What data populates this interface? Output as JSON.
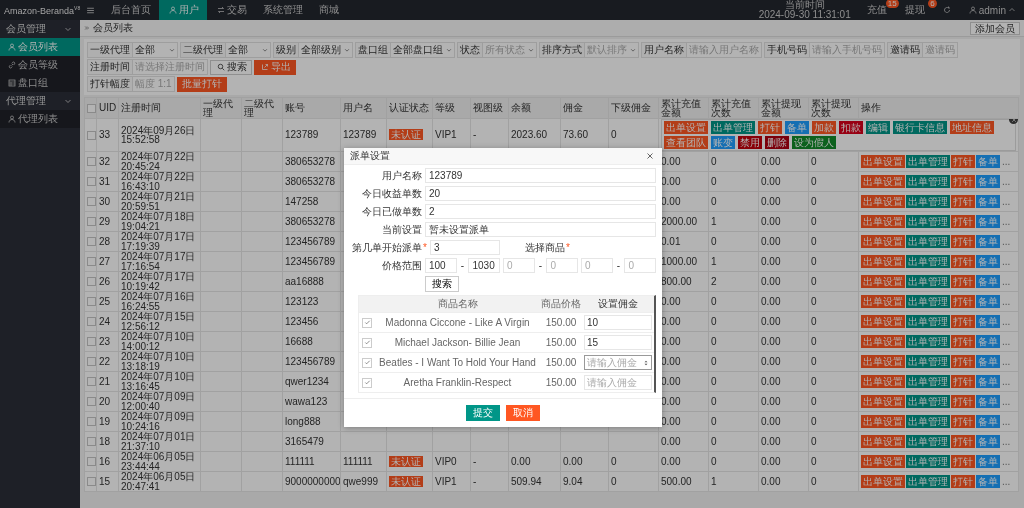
{
  "app": {
    "logo": "Amazon-Beranda",
    "version": "V8"
  },
  "top_nav": [
    {
      "label": "后台首页",
      "selected": false
    },
    {
      "label": "用户",
      "selected": true
    },
    {
      "label": "交易",
      "selected": false
    },
    {
      "label": "系统管理",
      "selected": false
    },
    {
      "label": "商城",
      "selected": false
    }
  ],
  "top_right": {
    "time_label": "当前时间",
    "time": "2024-09-30 11:31:01",
    "links": [
      {
        "label": "充值",
        "count": "15"
      },
      {
        "label": "提现",
        "count": "6"
      }
    ],
    "user": "admin"
  },
  "sidebar": [
    {
      "label": "会员管理",
      "expanded": true,
      "children": [
        {
          "label": "会员列表",
          "selected": true
        },
        {
          "label": "会员等级",
          "selected": false
        },
        {
          "label": "盘口组",
          "selected": false
        }
      ]
    },
    {
      "label": "代理管理",
      "expanded": true,
      "children": [
        {
          "label": "代理列表",
          "selected": false
        }
      ]
    }
  ],
  "breadcrumb": "会员列表",
  "add_button": "添加会员",
  "filter_rows": [
    [
      {
        "kind": "select",
        "label": "一级代理",
        "value": "全部"
      },
      {
        "kind": "select",
        "label": "二级代理",
        "value": "全部"
      },
      {
        "kind": "select",
        "label": "级别",
        "value": "全部级别"
      },
      {
        "kind": "select",
        "label": "盘口组",
        "value": "全部盘口组"
      },
      {
        "kind": "select",
        "label": "状态",
        "placeholder": "所有状态"
      },
      {
        "kind": "select",
        "label": "排序方式",
        "placeholder": "默认排序"
      },
      {
        "kind": "input",
        "label": "用户名称",
        "placeholder": "请输入用户名称"
      },
      {
        "kind": "input",
        "label": "手机号码",
        "placeholder": "请输入手机号码"
      },
      {
        "kind": "input",
        "label": "邀请码",
        "placeholder": "邀请码"
      }
    ],
    [
      {
        "kind": "input",
        "label": "注册时间",
        "placeholder": "请选择注册时间"
      },
      {
        "kind": "search",
        "label": "搜索"
      },
      {
        "kind": "export",
        "label": "导出"
      }
    ],
    [
      {
        "kind": "input",
        "label": "打针幅度",
        "placeholder": "幅度 1:1"
      },
      {
        "kind": "danger",
        "label": "批量打针"
      }
    ]
  ],
  "table": {
    "all_checked": false,
    "columns": [
      "UID",
      "注册时间",
      "一级代理",
      "二级代理",
      "账号",
      "用户名",
      "认证状态",
      "等级",
      "视图级",
      "余额",
      "佣金",
      "下级佣金",
      "累计充值金额",
      "累计充值次数",
      "累计提现金额",
      "累计提现次数",
      "操作"
    ],
    "rows": [
      {
        "checked": false,
        "cells": [
          "33",
          "2024年09月26日 15:52:58",
          null,
          null,
          "123789",
          "123789",
          "未认证",
          "VIP1",
          "-",
          "2023.60",
          "73.60",
          "0"
        ],
        "menu_open": true,
        "menu": [
          {
            "label": "出单设置",
            "color": "#b33d18"
          },
          {
            "label": "出单管理",
            "color": "#00695f"
          },
          {
            "label": "打针",
            "color": "#b33d18"
          },
          {
            "label": "备单",
            "color": "#156fb3"
          },
          {
            "label": "加款",
            "color": "#b33d18"
          },
          {
            "label": "扣款",
            "color": "#980013"
          },
          {
            "label": "编辑",
            "color": "#00695f"
          },
          {
            "label": "银行卡信息",
            "color": "#00695f"
          },
          {
            "label": "地址信息",
            "color": "#b33d18"
          },
          {
            "label": "查看团队",
            "color": "#b33d18"
          },
          {
            "label": "账变",
            "color": "#156fb3"
          },
          {
            "label": "禁用",
            "color": "#890008"
          },
          {
            "label": "删除",
            "color": "#7b000b"
          },
          {
            "label": "设为假人",
            "color": "#0c611d"
          }
        ]
      },
      {
        "checked": false,
        "cells": [
          "32",
          "2024年07月22日 20:45:24",
          null,
          null,
          "380653278",
          null,
          null,
          null,
          null,
          null,
          null,
          null
        ],
        "totals": [
          "0.00",
          "0",
          "0.00",
          "0"
        ],
        "menu_open": false,
        "ops": [
          {
            "label": "出单设置",
            "color": "#b33d18"
          },
          {
            "label": "出单管理",
            "color": "#00695f"
          },
          {
            "label": "打针",
            "color": "#b33d18"
          },
          {
            "label": "备单",
            "color": "#156fb3"
          }
        ],
        "more": "..."
      },
      {
        "checked": false,
        "cells": [
          "31",
          "2024年07月22日 16:43:10",
          null,
          null,
          "380653278",
          null,
          null,
          null,
          null,
          null,
          null,
          null
        ],
        "totals": [
          "0.00",
          "0",
          "0.00",
          "0"
        ],
        "menu_open": false,
        "ops": [
          {
            "label": "出单设置",
            "color": "#b33d18"
          },
          {
            "label": "出单管理",
            "color": "#00695f"
          },
          {
            "label": "打针",
            "color": "#b33d18"
          },
          {
            "label": "备单",
            "color": "#156fb3"
          }
        ],
        "more": "..."
      },
      {
        "checked": false,
        "cells": [
          "30",
          "2024年07月21日 20:59:51",
          null,
          null,
          "147258",
          null,
          null,
          null,
          null,
          null,
          null,
          null
        ],
        "totals": [
          "0.00",
          "0",
          "0.00",
          "0"
        ],
        "menu_open": false,
        "ops": [
          {
            "label": "出单设置",
            "color": "#b33d18"
          },
          {
            "label": "出单管理",
            "color": "#00695f"
          },
          {
            "label": "打针",
            "color": "#b33d18"
          },
          {
            "label": "备单",
            "color": "#156fb3"
          }
        ],
        "more": "..."
      },
      {
        "checked": false,
        "cells": [
          "29",
          "2024年07月18日 19:04:21",
          null,
          null,
          "380653278",
          null,
          null,
          null,
          null,
          null,
          null,
          null
        ],
        "totals": [
          "2000.00",
          "1",
          "0.00",
          "0"
        ],
        "menu_open": false,
        "ops": [
          {
            "label": "出单设置",
            "color": "#b33d18"
          },
          {
            "label": "出单管理",
            "color": "#00695f"
          },
          {
            "label": "打针",
            "color": "#b33d18"
          },
          {
            "label": "备单",
            "color": "#156fb3"
          }
        ],
        "more": "..."
      },
      {
        "checked": false,
        "cells": [
          "28",
          "2024年07月17日 17:19:39",
          null,
          null,
          "123456789",
          null,
          null,
          null,
          null,
          null,
          null,
          null
        ],
        "totals": [
          "0.01",
          "0",
          "0.00",
          "0"
        ],
        "menu_open": false,
        "ops": [
          {
            "label": "出单设置",
            "color": "#b33d18"
          },
          {
            "label": "出单管理",
            "color": "#00695f"
          },
          {
            "label": "打针",
            "color": "#b33d18"
          },
          {
            "label": "备单",
            "color": "#156fb3"
          }
        ],
        "more": "..."
      },
      {
        "checked": false,
        "cells": [
          "27",
          "2024年07月17日 17:16:54",
          null,
          null,
          "123456789",
          null,
          null,
          null,
          null,
          null,
          null,
          null
        ],
        "totals": [
          "1000.00",
          "1",
          "0.00",
          "0"
        ],
        "menu_open": false,
        "ops": [
          {
            "label": "出单设置",
            "color": "#b33d18"
          },
          {
            "label": "出单管理",
            "color": "#00695f"
          },
          {
            "label": "打针",
            "color": "#b33d18"
          },
          {
            "label": "备单",
            "color": "#156fb3"
          }
        ],
        "more": "..."
      },
      {
        "checked": false,
        "cells": [
          "26",
          "2024年07月17日 10:19:42",
          null,
          null,
          "aa16888",
          null,
          null,
          null,
          null,
          null,
          null,
          null
        ],
        "totals": [
          "800.00",
          "2",
          "0.00",
          "0"
        ],
        "menu_open": false,
        "ops": [
          {
            "label": "出单设置",
            "color": "#b33d18"
          },
          {
            "label": "出单管理",
            "color": "#00695f"
          },
          {
            "label": "打针",
            "color": "#b33d18"
          },
          {
            "label": "备单",
            "color": "#156fb3"
          }
        ],
        "more": "..."
      },
      {
        "checked": false,
        "cells": [
          "25",
          "2024年07月16日 16:24:55",
          null,
          null,
          "123123",
          null,
          null,
          null,
          null,
          null,
          null,
          null
        ],
        "totals": [
          "0.00",
          "0",
          "0.00",
          "0"
        ],
        "menu_open": false,
        "ops": [
          {
            "label": "出单设置",
            "color": "#b33d18"
          },
          {
            "label": "出单管理",
            "color": "#00695f"
          },
          {
            "label": "打针",
            "color": "#b33d18"
          },
          {
            "label": "备单",
            "color": "#156fb3"
          }
        ],
        "more": "..."
      },
      {
        "checked": false,
        "cells": [
          "24",
          "2024年07月15日 12:56:12",
          null,
          null,
          "123456",
          null,
          null,
          null,
          null,
          null,
          null,
          null
        ],
        "totals": [
          "0.00",
          "0",
          "0.00",
          "0"
        ],
        "menu_open": false,
        "ops": [
          {
            "label": "出单设置",
            "color": "#b33d18"
          },
          {
            "label": "出单管理",
            "color": "#00695f"
          },
          {
            "label": "打针",
            "color": "#b33d18"
          },
          {
            "label": "备单",
            "color": "#156fb3"
          }
        ],
        "more": "..."
      },
      {
        "checked": false,
        "cells": [
          "23",
          "2024年07月10日 14:00:12",
          null,
          null,
          "16688",
          null,
          null,
          null,
          null,
          null,
          null,
          null
        ],
        "totals": [
          "0.00",
          "0",
          "0.00",
          "0"
        ],
        "menu_open": false,
        "ops": [
          {
            "label": "出单设置",
            "color": "#b33d18"
          },
          {
            "label": "出单管理",
            "color": "#00695f"
          },
          {
            "label": "打针",
            "color": "#b33d18"
          },
          {
            "label": "备单",
            "color": "#156fb3"
          }
        ],
        "more": "..."
      },
      {
        "checked": false,
        "cells": [
          "22",
          "2024年07月10日 13:18:19",
          null,
          null,
          "123456789",
          null,
          null,
          null,
          null,
          null,
          null,
          null
        ],
        "totals": [
          "0.00",
          "0",
          "0.00",
          "0"
        ],
        "menu_open": false,
        "ops": [
          {
            "label": "出单设置",
            "color": "#b33d18"
          },
          {
            "label": "出单管理",
            "color": "#00695f"
          },
          {
            "label": "打针",
            "color": "#b33d18"
          },
          {
            "label": "备单",
            "color": "#156fb3"
          }
        ],
        "more": "..."
      },
      {
        "checked": false,
        "cells": [
          "21",
          "2024年07月10日 13:16:45",
          null,
          null,
          "qwer1234",
          null,
          null,
          null,
          null,
          null,
          null,
          null
        ],
        "totals": [
          "0.00",
          "0",
          "0.00",
          "0"
        ],
        "menu_open": false,
        "ops": [
          {
            "label": "出单设置",
            "color": "#b33d18"
          },
          {
            "label": "出单管理",
            "color": "#00695f"
          },
          {
            "label": "打针",
            "color": "#b33d18"
          },
          {
            "label": "备单",
            "color": "#156fb3"
          }
        ],
        "more": "..."
      },
      {
        "checked": false,
        "cells": [
          "20",
          "2024年07月09日 12:00:40",
          null,
          null,
          "wawa123",
          null,
          null,
          null,
          null,
          null,
          null,
          null
        ],
        "totals": [
          "0.00",
          "0",
          "0.00",
          "0"
        ],
        "menu_open": false,
        "ops": [
          {
            "label": "出单设置",
            "color": "#b33d18"
          },
          {
            "label": "出单管理",
            "color": "#00695f"
          },
          {
            "label": "打针",
            "color": "#b33d18"
          },
          {
            "label": "备单",
            "color": "#156fb3"
          }
        ],
        "more": "..."
      },
      {
        "checked": false,
        "cells": [
          "19",
          "2024年07月09日 10:24:16",
          null,
          null,
          "long888",
          null,
          null,
          null,
          null,
          null,
          null,
          null
        ],
        "totals": [
          "0.00",
          "0",
          "0.00",
          "0"
        ],
        "menu_open": false,
        "ops": [
          {
            "label": "出单设置",
            "color": "#b33d18"
          },
          {
            "label": "出单管理",
            "color": "#00695f"
          },
          {
            "label": "打针",
            "color": "#b33d18"
          },
          {
            "label": "备单",
            "color": "#156fb3"
          }
        ],
        "more": "..."
      },
      {
        "checked": false,
        "cells": [
          "18",
          "2024年07月01日 21:37:10",
          null,
          null,
          "3165479",
          null,
          null,
          null,
          null,
          null,
          null,
          null
        ],
        "totals": [
          "0.00",
          "0",
          "0.00",
          "0"
        ],
        "menu_open": false,
        "ops": [
          {
            "label": "出单设置",
            "color": "#b33d18"
          },
          {
            "label": "出单管理",
            "color": "#00695f"
          },
          {
            "label": "打针",
            "color": "#b33d18"
          },
          {
            "label": "备单",
            "color": "#156fb3"
          }
        ],
        "more": "..."
      },
      {
        "checked": false,
        "cells": [
          "16",
          "2024年06月05日 23:44:44",
          null,
          null,
          "111111",
          "111111",
          "未认证",
          "VIP0",
          "-",
          "0.00",
          "0.00",
          "0"
        ],
        "totals": [
          "0.00",
          "0",
          "0.00",
          "0"
        ],
        "menu_open": false,
        "ops": [
          {
            "label": "出单设置",
            "color": "#b33d18"
          },
          {
            "label": "出单管理",
            "color": "#00695f"
          },
          {
            "label": "打针",
            "color": "#b33d18"
          },
          {
            "label": "备单",
            "color": "#156fb3"
          }
        ],
        "more": "..."
      },
      {
        "checked": false,
        "cells": [
          "15",
          "2024年06月05日 20:47:41",
          null,
          null,
          "9000000000",
          "qwe999",
          "未认证",
          "VIP1",
          "-",
          "509.94",
          "9.04",
          "0"
        ],
        "totals": [
          "500.00",
          "1",
          "0.00",
          "0"
        ],
        "menu_open": false,
        "ops": [
          {
            "label": "出单设置",
            "color": "#b33d18"
          },
          {
            "label": "出单管理",
            "color": "#00695f"
          },
          {
            "label": "打针",
            "color": "#b33d18"
          },
          {
            "label": "备单",
            "color": "#156fb3"
          }
        ],
        "more": "..."
      }
    ]
  },
  "modal": {
    "title": "派单设置",
    "fields": [
      {
        "label": "用户名称",
        "value": "123789"
      },
      {
        "label": "今日收益单数",
        "value": "20"
      },
      {
        "label": "今日已做单数",
        "value": "2"
      },
      {
        "label": "当前设置",
        "value": "暂未设置派单"
      }
    ],
    "start": {
      "label": "第几单开始派单",
      "mark": "*",
      "value": "3"
    },
    "goods": {
      "label": "选择商品",
      "mark": "*"
    },
    "price": {
      "label": "价格范围",
      "separator": "-",
      "inputs": [
        {
          "value": "100"
        },
        {
          "value": "1030"
        },
        {
          "placeholder": "0"
        },
        {
          "placeholder": "0"
        },
        {
          "placeholder": "0"
        },
        {
          "placeholder": "0"
        }
      ]
    },
    "search_button": "搜索",
    "goods_table": {
      "columns": [
        "商品名称",
        "商品价格",
        "设置佣金"
      ],
      "rows": [
        {
          "checked": true,
          "name": "Madonna Ciccone - Like A Virgin",
          "price": "150.00",
          "value": "10",
          "focused": false
        },
        {
          "checked": true,
          "name": "Michael Jackson- Billie Jean",
          "price": "150.00",
          "value": "15",
          "focused": false
        },
        {
          "checked": true,
          "name": "Beatles - I Want To Hold Your Hand",
          "price": "150.00",
          "placeholder": "请输入佣金",
          "focused": true
        },
        {
          "checked": true,
          "name": "Aretha Franklin-Respect",
          "price": "150.00",
          "placeholder": "请输入佣金",
          "focused": false
        }
      ]
    },
    "buttons": [
      {
        "label": "提交",
        "kind": "primary"
      },
      {
        "label": "取消",
        "kind": "warn"
      }
    ]
  }
}
